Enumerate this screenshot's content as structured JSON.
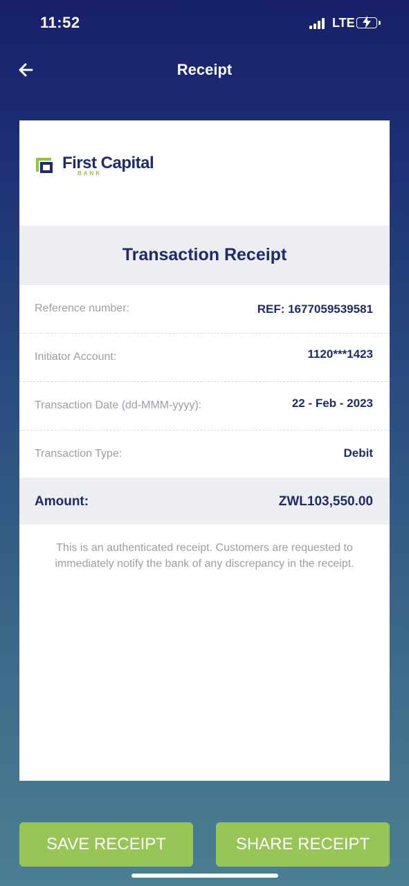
{
  "status_bar": {
    "time": "11:52",
    "network": "LTE"
  },
  "nav": {
    "title": "Receipt"
  },
  "brand": {
    "name": "First Capital",
    "sub": "BANK",
    "primary_color": "#1f2a6b",
    "accent_color": "#8cc63f"
  },
  "receipt": {
    "title": "Transaction Receipt",
    "rows": [
      {
        "label": "Reference number:",
        "value": "REF: 1677059539581"
      },
      {
        "label": "Initiator Account:",
        "value": "1120***1423"
      },
      {
        "label": "Transaction Date (dd-MMM-yyyy):",
        "value": "22 - Feb - 2023"
      },
      {
        "label": "Transaction Type:",
        "value": "Debit"
      }
    ],
    "amount_label": "Amount:",
    "amount_value": "ZWL103,550.00",
    "disclaimer": "This is an authenticated receipt. Customers are requested to immediately notify the bank of any discrepancy in the receipt."
  },
  "actions": {
    "save_label": "SAVE RECEIPT",
    "share_label": "SHARE RECEIPT",
    "button_color": "#97c556"
  }
}
